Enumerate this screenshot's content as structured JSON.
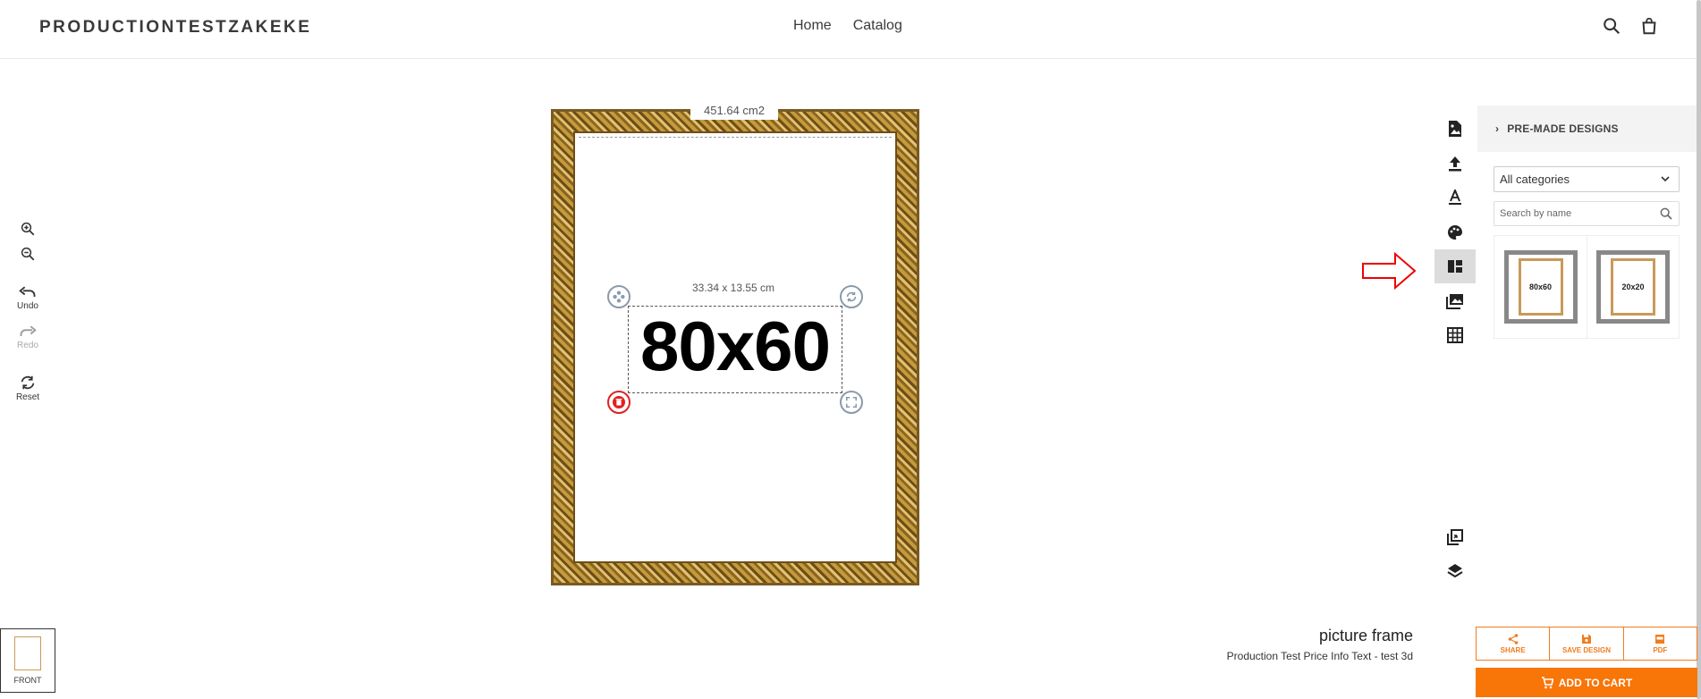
{
  "header": {
    "logo": "PRODUCTIONTESTZAKEKE",
    "nav": [
      "Home",
      "Catalog"
    ]
  },
  "left_tools": {
    "undo": "Undo",
    "redo": "Redo",
    "reset": "Reset"
  },
  "canvas": {
    "area_label": "451.64 cm2",
    "selection_dims": "33.34 x 13.55 cm",
    "text_content": "80x60"
  },
  "panel": {
    "title": "PRE-MADE DESIGNS",
    "category_select": "All categories",
    "search_placeholder": "Search by name",
    "designs": [
      {
        "label": "80x60"
      },
      {
        "label": "20x20"
      }
    ]
  },
  "views": {
    "front_label": "FRONT"
  },
  "product": {
    "name": "picture frame",
    "description": "Production Test Price Info Text - test 3d"
  },
  "actions": {
    "share": "SHARE",
    "save_design": "SAVE DESIGN",
    "pdf": "PDF",
    "add_to_cart": "ADD TO CART"
  },
  "colors": {
    "accent": "#f87508",
    "annotation": "#ee0000"
  }
}
